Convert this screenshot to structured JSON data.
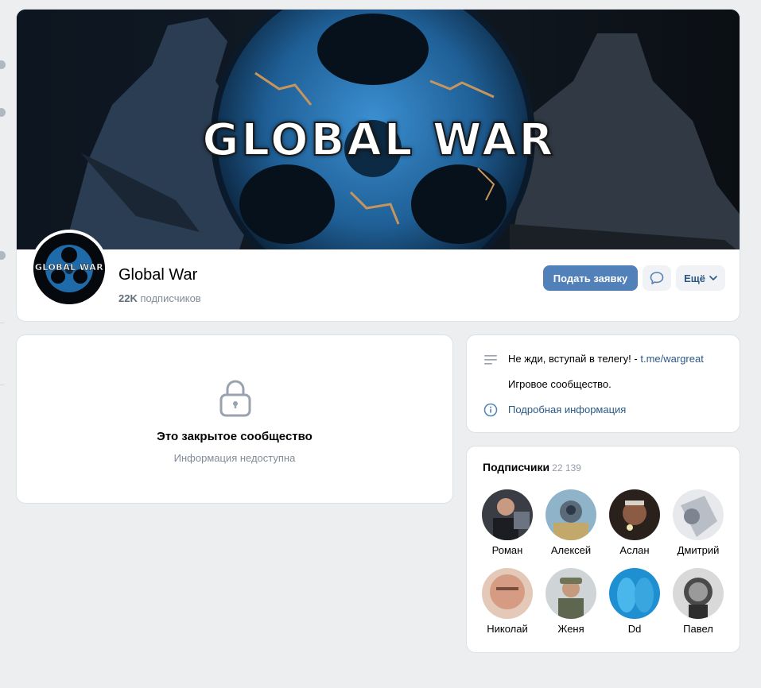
{
  "group": {
    "cover_text": "GLOBAL WAR",
    "avatar_text": "GLOBAL WAR",
    "name": "Global War",
    "subscribers_short": "22K",
    "subscribers_word": "подписчиков"
  },
  "actions": {
    "apply_label": "Подать заявку",
    "more_label": "Ещё"
  },
  "closed": {
    "title": "Это закрытое сообщество",
    "subtitle": "Информация недоступна"
  },
  "info": {
    "status_text": "Не жди, вступай в телегу! - ",
    "status_link": "t.me/wargreat",
    "description": "Игровое сообщество.",
    "details_link": "Подробная информация"
  },
  "members": {
    "title": "Подписчики",
    "count": "22 139",
    "list": [
      {
        "name": "Роман"
      },
      {
        "name": "Алексей"
      },
      {
        "name": "Аслан"
      },
      {
        "name": "Дмитрий"
      },
      {
        "name": "Николай"
      },
      {
        "name": "Женя"
      },
      {
        "name": "Dd"
      },
      {
        "name": "Павел"
      }
    ]
  },
  "colors": {
    "accent": "#5181b8",
    "link": "#2a5885",
    "page_bg": "#edeef0",
    "muted_text": "#818c99"
  },
  "icons": {
    "lock": "lock-icon",
    "message": "message-icon",
    "chevron": "chevron-down-icon",
    "status": "lines-icon",
    "info": "info-icon"
  }
}
